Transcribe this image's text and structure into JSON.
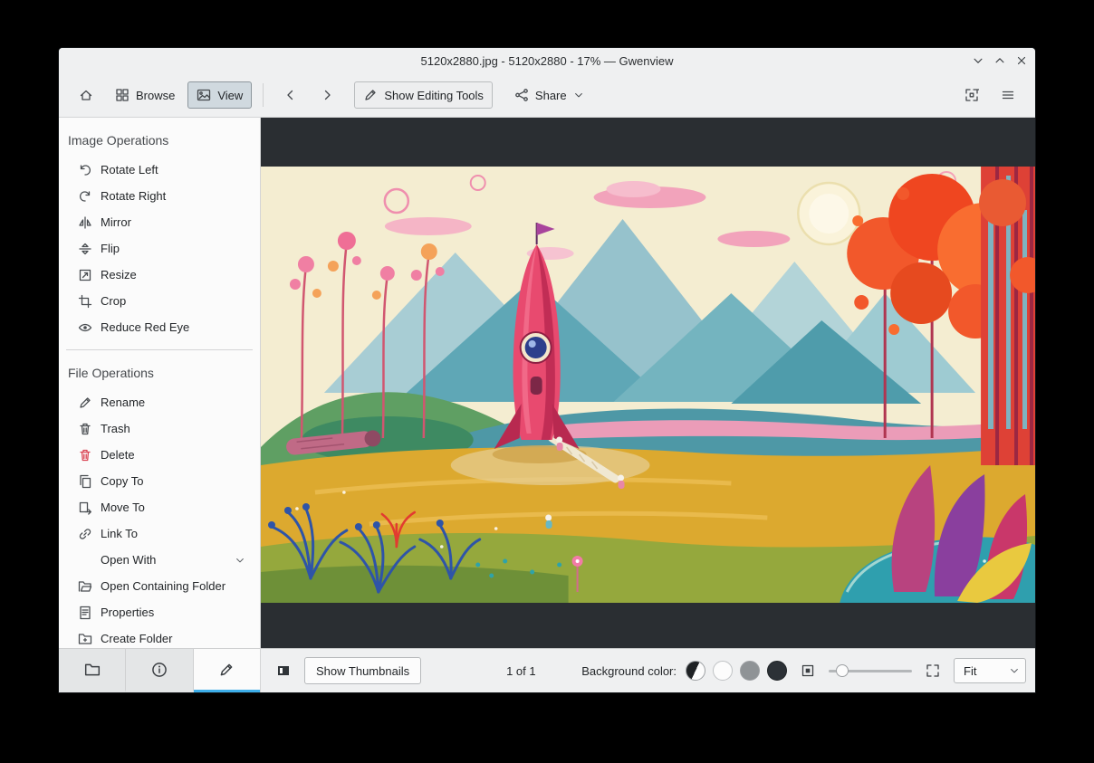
{
  "window": {
    "title": "5120x2880.jpg - 5120x2880 - 17% — Gwenview"
  },
  "toolbar": {
    "browse": "Browse",
    "view": "View",
    "show_editing_tools": "Show Editing Tools",
    "share": "Share"
  },
  "sidebar": {
    "sections": [
      {
        "heading": "Image Operations",
        "items": [
          {
            "label": "Rotate Left",
            "icon": "rotate-left-icon"
          },
          {
            "label": "Rotate Right",
            "icon": "rotate-right-icon"
          },
          {
            "label": "Mirror",
            "icon": "mirror-icon"
          },
          {
            "label": "Flip",
            "icon": "flip-icon"
          },
          {
            "label": "Resize",
            "icon": "resize-icon"
          },
          {
            "label": "Crop",
            "icon": "crop-icon"
          },
          {
            "label": "Reduce Red Eye",
            "icon": "red-eye-icon"
          }
        ]
      },
      {
        "heading": "File Operations",
        "items": [
          {
            "label": "Rename",
            "icon": "rename-icon"
          },
          {
            "label": "Trash",
            "icon": "trash-icon"
          },
          {
            "label": "Delete",
            "icon": "delete-icon",
            "color": "#da4453"
          },
          {
            "label": "Copy To",
            "icon": "copy-icon"
          },
          {
            "label": "Move To",
            "icon": "move-icon"
          },
          {
            "label": "Link To",
            "icon": "link-icon"
          },
          {
            "label": "Open With",
            "icon": "chevron-down-icon"
          },
          {
            "label": "Open Containing Folder",
            "icon": "folder-open-icon"
          },
          {
            "label": "Properties",
            "icon": "properties-icon"
          },
          {
            "label": "Create Folder",
            "icon": "folder-new-icon"
          }
        ]
      }
    ],
    "tabs": [
      {
        "icon": "folder-icon"
      },
      {
        "icon": "info-icon"
      },
      {
        "icon": "edit-icon",
        "active": true
      }
    ]
  },
  "statusbar": {
    "show_thumbnails": "Show Thumbnails",
    "page_indicator": "1 of 1",
    "background_color_label": "Background color:",
    "zoom_mode": "Fit",
    "swatches": [
      "auto",
      "white",
      "gray",
      "black"
    ]
  },
  "colors": {
    "accent": "#3daee9",
    "delete": "#da4453",
    "viewer_background": "#2a2e32"
  }
}
